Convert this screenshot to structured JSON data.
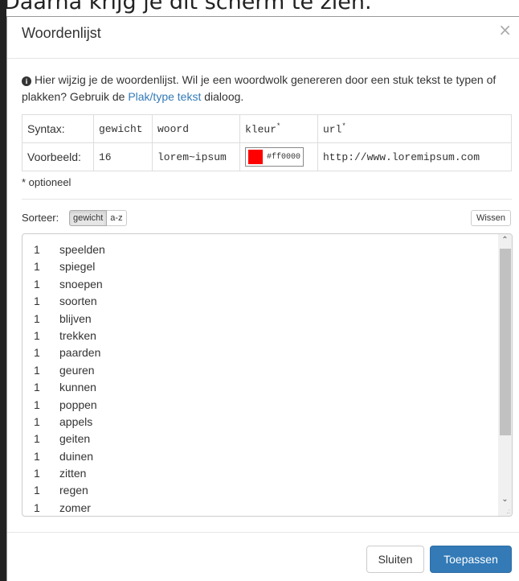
{
  "background_caption": "Daarna krijg je dit scherm te zien.",
  "modal": {
    "title": "Woordenlijst",
    "close_glyph": "×",
    "intro_text": "Hier wijzig je de woordenlijst. Wil je een woordwolk genereren door een stuk tekst te typen of plakken? Gebruik de ",
    "intro_link": "Plak/type tekst",
    "intro_suffix": " dialoog.",
    "info_icon": "info-circle-icon"
  },
  "syntax_table": {
    "row1": {
      "label": "Syntax:",
      "gewicht": "gewicht",
      "woord": "woord",
      "kleur": "kleur",
      "kleur_marker": "*",
      "url": "url",
      "url_marker": "*"
    },
    "row2": {
      "label": "Voorbeeld:",
      "gewicht": "16",
      "woord": "lorem~ipsum",
      "kleur_value": "#ff0000",
      "url": "http://www.loremipsum.com"
    }
  },
  "optional_note": "* optioneel",
  "sort": {
    "label": "Sorteer:",
    "options": [
      "gewicht",
      "a-z"
    ],
    "active": "gewicht",
    "clear_label": "Wissen"
  },
  "words": [
    {
      "weight": "1",
      "word": "speelden"
    },
    {
      "weight": "1",
      "word": "spiegel"
    },
    {
      "weight": "1",
      "word": "snoepen"
    },
    {
      "weight": "1",
      "word": "soorten"
    },
    {
      "weight": "1",
      "word": "blijven"
    },
    {
      "weight": "1",
      "word": "trekken"
    },
    {
      "weight": "1",
      "word": "paarden"
    },
    {
      "weight": "1",
      "word": "geuren"
    },
    {
      "weight": "1",
      "word": "kunnen"
    },
    {
      "weight": "1",
      "word": "poppen"
    },
    {
      "weight": "1",
      "word": "appels"
    },
    {
      "weight": "1",
      "word": "geiten"
    },
    {
      "weight": "1",
      "word": "duinen"
    },
    {
      "weight": "1",
      "word": "zitten"
    },
    {
      "weight": "1",
      "word": "regen"
    },
    {
      "weight": "1",
      "word": "zomer"
    }
  ],
  "footer": {
    "close_label": "Sluiten",
    "apply_label": "Toepassen"
  },
  "colors": {
    "primary": "#337ab7",
    "example_color": "#ff0000"
  }
}
